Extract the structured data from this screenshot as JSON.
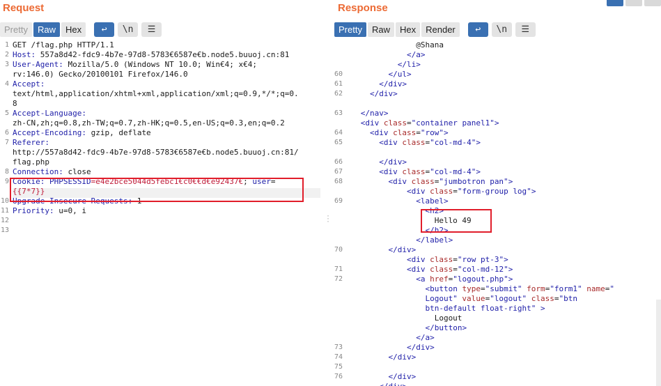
{
  "request": {
    "title": "Request",
    "tabs": [
      {
        "label": "Pretty",
        "state": "disabled"
      },
      {
        "label": "Raw",
        "state": "active"
      },
      {
        "label": "Hex",
        "state": "normal"
      }
    ],
    "toolbar_icons": [
      {
        "name": "wrap-lines-icon",
        "glyph": "↩",
        "active": true
      },
      {
        "name": "newline-icon",
        "glyph": "\\n",
        "active": false
      },
      {
        "name": "menu-icon",
        "glyph": "☰",
        "active": false
      }
    ],
    "lines": [
      {
        "n": "1",
        "parts": [
          {
            "t": "GET /flag.php HTTP/1.1",
            "c": "hv"
          }
        ]
      },
      {
        "n": "2",
        "parts": [
          {
            "t": "Host:",
            "c": "hk"
          },
          {
            "t": " 557a8d42-fdc9-4b7e-97d8-5783€6587e€b.node5.buuoj.cn:81",
            "c": "hv"
          }
        ]
      },
      {
        "n": "3",
        "parts": [
          {
            "t": "User-Agent:",
            "c": "hk"
          },
          {
            "t": " Mozilla/5.0 (Windows NT 10.0; Win€4; x€4;",
            "c": "hv"
          }
        ]
      },
      {
        "n": "",
        "parts": [
          {
            "t": "rv:146.0) Gecko/20100101 Firefox/146.0",
            "c": "hv"
          }
        ]
      },
      {
        "n": "4",
        "parts": [
          {
            "t": "Accept:",
            "c": "hk"
          }
        ]
      },
      {
        "n": "",
        "parts": [
          {
            "t": "text/html,application/xhtml+xml,application/xml;q=0.9,*/*;q=0.",
            "c": "hv"
          }
        ]
      },
      {
        "n": "",
        "parts": [
          {
            "t": "8",
            "c": "hv"
          }
        ]
      },
      {
        "n": "5",
        "parts": [
          {
            "t": "Accept-Language:",
            "c": "hk"
          }
        ]
      },
      {
        "n": "",
        "parts": [
          {
            "t": "zh-CN,zh;q=0.8,zh-TW;q=0.7,zh-HK;q=0.5,en-US;q=0.3,en;q=0.2",
            "c": "hv"
          }
        ]
      },
      {
        "n": "6",
        "parts": [
          {
            "t": "Accept-Encoding:",
            "c": "hk"
          },
          {
            "t": " gzip, deflate",
            "c": "hv"
          }
        ]
      },
      {
        "n": "7",
        "parts": [
          {
            "t": "Referer:",
            "c": "hk"
          }
        ]
      },
      {
        "n": "",
        "parts": [
          {
            "t": "http://557a8d42-fdc9-4b7e-97d8-5783€6587e€b.node5.buuoj.cn:81/",
            "c": "hv"
          }
        ]
      },
      {
        "n": "",
        "parts": [
          {
            "t": "flag.php",
            "c": "hv"
          }
        ]
      },
      {
        "n": "8",
        "parts": [
          {
            "t": "Connection:",
            "c": "hk"
          },
          {
            "t": " close",
            "c": "hv"
          }
        ]
      },
      {
        "n": "9",
        "parts": [
          {
            "t": "Cookie:",
            "c": "hk"
          },
          {
            "t": " PHPSESSID",
            "c": "ck"
          },
          {
            "t": "=e4e2bce5044d5febc1€c0€€d€e92437€",
            "c": "cv"
          },
          {
            "t": "; ",
            "c": "hv"
          },
          {
            "t": "user",
            "c": "ck"
          },
          {
            "t": "=",
            "c": "hv"
          }
        ]
      },
      {
        "n": "",
        "parts": [
          {
            "t": "{{7*7}}",
            "c": "cv"
          }
        ]
      },
      {
        "n": "10",
        "parts": [
          {
            "t": "Upgrade-Insecure-Requests:",
            "c": "hk"
          },
          {
            "t": " 1",
            "c": "hv"
          }
        ]
      },
      {
        "n": "11",
        "parts": [
          {
            "t": "Priority:",
            "c": "hk"
          },
          {
            "t": " u=0, i",
            "c": "hv"
          }
        ]
      },
      {
        "n": "12",
        "parts": []
      },
      {
        "n": "13",
        "parts": []
      }
    ]
  },
  "response": {
    "title": "Response",
    "tabs": [
      {
        "label": "Pretty",
        "state": "active"
      },
      {
        "label": "Raw",
        "state": "normal"
      },
      {
        "label": "Hex",
        "state": "normal"
      },
      {
        "label": "Render",
        "state": "normal"
      }
    ],
    "toolbar_icons": [
      {
        "name": "wrap-lines-icon",
        "glyph": "↩",
        "active": true
      },
      {
        "name": "newline-icon",
        "glyph": "\\n",
        "active": false
      },
      {
        "name": "menu-icon",
        "glyph": "☰",
        "active": false
      }
    ],
    "lines": [
      {
        "n": "",
        "parts": [
          {
            "t": "                  @Shana",
            "c": "tx"
          }
        ]
      },
      {
        "n": "",
        "parts": [
          {
            "t": "                </",
            "c": "tg"
          },
          {
            "t": "a",
            "c": "tg"
          },
          {
            "t": ">",
            "c": "tg"
          }
        ]
      },
      {
        "n": "",
        "parts": [
          {
            "t": "              </",
            "c": "tg"
          },
          {
            "t": "li",
            "c": "tg"
          },
          {
            "t": ">",
            "c": "tg"
          }
        ]
      },
      {
        "n": "60",
        "parts": [
          {
            "t": "            </",
            "c": "tg"
          },
          {
            "t": "ul",
            "c": "tg"
          },
          {
            "t": ">",
            "c": "tg"
          }
        ]
      },
      {
        "n": "61",
        "parts": [
          {
            "t": "          </",
            "c": "tg"
          },
          {
            "t": "div",
            "c": "tg"
          },
          {
            "t": ">",
            "c": "tg"
          }
        ]
      },
      {
        "n": "62",
        "parts": [
          {
            "t": "        </",
            "c": "tg"
          },
          {
            "t": "div",
            "c": "tg"
          },
          {
            "t": ">",
            "c": "tg"
          }
        ]
      },
      {
        "n": "",
        "parts": []
      },
      {
        "n": "63",
        "parts": [
          {
            "t": "      </",
            "c": "tg"
          },
          {
            "t": "nav",
            "c": "tg"
          },
          {
            "t": ">",
            "c": "tg"
          }
        ]
      },
      {
        "n": "",
        "parts": [
          {
            "t": "      <",
            "c": "tg"
          },
          {
            "t": "div",
            "c": "tg"
          },
          {
            "t": " class",
            "c": "at"
          },
          {
            "t": "=",
            "c": "tx"
          },
          {
            "t": "\"container panel1\"",
            "c": "st"
          },
          {
            "t": ">",
            "c": "tg"
          }
        ]
      },
      {
        "n": "64",
        "parts": [
          {
            "t": "        <",
            "c": "tg"
          },
          {
            "t": "div",
            "c": "tg"
          },
          {
            "t": " class",
            "c": "at"
          },
          {
            "t": "=",
            "c": "tx"
          },
          {
            "t": "\"row\"",
            "c": "st"
          },
          {
            "t": ">",
            "c": "tg"
          }
        ]
      },
      {
        "n": "65",
        "parts": [
          {
            "t": "          <",
            "c": "tg"
          },
          {
            "t": "div",
            "c": "tg"
          },
          {
            "t": " class",
            "c": "at"
          },
          {
            "t": "=",
            "c": "tx"
          },
          {
            "t": "\"col-md-4\"",
            "c": "st"
          },
          {
            "t": ">",
            "c": "tg"
          }
        ]
      },
      {
        "n": "",
        "parts": []
      },
      {
        "n": "66",
        "parts": [
          {
            "t": "          </",
            "c": "tg"
          },
          {
            "t": "div",
            "c": "tg"
          },
          {
            "t": ">",
            "c": "tg"
          }
        ]
      },
      {
        "n": "67",
        "parts": [
          {
            "t": "          <",
            "c": "tg"
          },
          {
            "t": "div",
            "c": "tg"
          },
          {
            "t": " class",
            "c": "at"
          },
          {
            "t": "=",
            "c": "tx"
          },
          {
            "t": "\"col-md-4\"",
            "c": "st"
          },
          {
            "t": ">",
            "c": "tg"
          }
        ]
      },
      {
        "n": "68",
        "parts": [
          {
            "t": "            <",
            "c": "tg"
          },
          {
            "t": "div",
            "c": "tg"
          },
          {
            "t": " class",
            "c": "at"
          },
          {
            "t": "=",
            "c": "tx"
          },
          {
            "t": "\"jumbotron pan\"",
            "c": "st"
          },
          {
            "t": ">",
            "c": "tg"
          }
        ]
      },
      {
        "n": "",
        "parts": [
          {
            "t": "                <",
            "c": "tg"
          },
          {
            "t": "div",
            "c": "tg"
          },
          {
            "t": " class",
            "c": "at"
          },
          {
            "t": "=",
            "c": "tx"
          },
          {
            "t": "\"form-group log\"",
            "c": "st"
          },
          {
            "t": ">",
            "c": "tg"
          }
        ]
      },
      {
        "n": "69",
        "parts": [
          {
            "t": "                  <",
            "c": "tg"
          },
          {
            "t": "label",
            "c": "tg"
          },
          {
            "t": ">",
            "c": "tg"
          }
        ]
      },
      {
        "n": "",
        "parts": [
          {
            "t": "                    <",
            "c": "tg"
          },
          {
            "t": "h2",
            "c": "tg"
          },
          {
            "t": ">",
            "c": "tg"
          }
        ]
      },
      {
        "n": "",
        "parts": [
          {
            "t": "                      Hello 49",
            "c": "tx"
          }
        ]
      },
      {
        "n": "",
        "parts": [
          {
            "t": "                    </",
            "c": "tg"
          },
          {
            "t": "h2",
            "c": "tg"
          },
          {
            "t": ">",
            "c": "tg"
          }
        ]
      },
      {
        "n": "",
        "parts": [
          {
            "t": "                  </",
            "c": "tg"
          },
          {
            "t": "label",
            "c": "tg"
          },
          {
            "t": ">",
            "c": "tg"
          }
        ]
      },
      {
        "n": "70",
        "parts": [
          {
            "t": "            </",
            "c": "tg"
          },
          {
            "t": "div",
            "c": "tg"
          },
          {
            "t": ">",
            "c": "tg"
          }
        ]
      },
      {
        "n": "",
        "parts": [
          {
            "t": "                <",
            "c": "tg"
          },
          {
            "t": "div",
            "c": "tg"
          },
          {
            "t": " class",
            "c": "at"
          },
          {
            "t": "=",
            "c": "tx"
          },
          {
            "t": "\"row pt-3\"",
            "c": "st"
          },
          {
            "t": ">",
            "c": "tg"
          }
        ]
      },
      {
        "n": "71",
        "parts": [
          {
            "t": "                <",
            "c": "tg"
          },
          {
            "t": "div",
            "c": "tg"
          },
          {
            "t": " class",
            "c": "at"
          },
          {
            "t": "=",
            "c": "tx"
          },
          {
            "t": "\"col-md-12\"",
            "c": "st"
          },
          {
            "t": ">",
            "c": "tg"
          }
        ]
      },
      {
        "n": "72",
        "parts": [
          {
            "t": "                  <",
            "c": "tg"
          },
          {
            "t": "a",
            "c": "tg"
          },
          {
            "t": " href",
            "c": "at"
          },
          {
            "t": "=",
            "c": "tx"
          },
          {
            "t": "\"logout.php\"",
            "c": "st"
          },
          {
            "t": ">",
            "c": "tg"
          }
        ]
      },
      {
        "n": "",
        "parts": [
          {
            "t": "                    <",
            "c": "tg"
          },
          {
            "t": "button",
            "c": "tg"
          },
          {
            "t": " type",
            "c": "at"
          },
          {
            "t": "=",
            "c": "tx"
          },
          {
            "t": "\"submit\"",
            "c": "st"
          },
          {
            "t": " form",
            "c": "at"
          },
          {
            "t": "=",
            "c": "tx"
          },
          {
            "t": "\"form1\"",
            "c": "st"
          },
          {
            "t": " name",
            "c": "at"
          },
          {
            "t": "=",
            "c": "tx"
          },
          {
            "t": "\"",
            "c": "st"
          }
        ]
      },
      {
        "n": "",
        "parts": [
          {
            "t": "                    Logout\"",
            "c": "st"
          },
          {
            "t": " value",
            "c": "at"
          },
          {
            "t": "=",
            "c": "tx"
          },
          {
            "t": "\"logout\"",
            "c": "st"
          },
          {
            "t": " class",
            "c": "at"
          },
          {
            "t": "=",
            "c": "tx"
          },
          {
            "t": "\"btn",
            "c": "st"
          }
        ]
      },
      {
        "n": "",
        "parts": [
          {
            "t": "                    btn-default float-right\"",
            "c": "st"
          },
          {
            "t": " >",
            "c": "tg"
          }
        ]
      },
      {
        "n": "",
        "parts": [
          {
            "t": "                      Logout",
            "c": "tx"
          }
        ]
      },
      {
        "n": "",
        "parts": [
          {
            "t": "                    </",
            "c": "tg"
          },
          {
            "t": "button",
            "c": "tg"
          },
          {
            "t": ">",
            "c": "tg"
          }
        ]
      },
      {
        "n": "",
        "parts": [
          {
            "t": "                  </",
            "c": "tg"
          },
          {
            "t": "a",
            "c": "tg"
          },
          {
            "t": ">",
            "c": "tg"
          }
        ]
      },
      {
        "n": "73",
        "parts": [
          {
            "t": "                </",
            "c": "tg"
          },
          {
            "t": "div",
            "c": "tg"
          },
          {
            "t": ">",
            "c": "tg"
          }
        ]
      },
      {
        "n": "74",
        "parts": [
          {
            "t": "            </",
            "c": "tg"
          },
          {
            "t": "div",
            "c": "tg"
          },
          {
            "t": ">",
            "c": "tg"
          }
        ]
      },
      {
        "n": "75",
        "parts": []
      },
      {
        "n": "76",
        "parts": [
          {
            "t": "            </",
            "c": "tg"
          },
          {
            "t": "div",
            "c": "tg"
          },
          {
            "t": ">",
            "c": "tg"
          }
        ]
      },
      {
        "n": "",
        "parts": [
          {
            "t": "          </",
            "c": "tg"
          },
          {
            "t": "div",
            "c": "tg"
          },
          {
            "t": ">",
            "c": "tg"
          }
        ]
      }
    ]
  },
  "colors": {
    "title": "#ec6a34",
    "active_tab": "#3a70b2",
    "highlight_box": "#e11d2a"
  }
}
